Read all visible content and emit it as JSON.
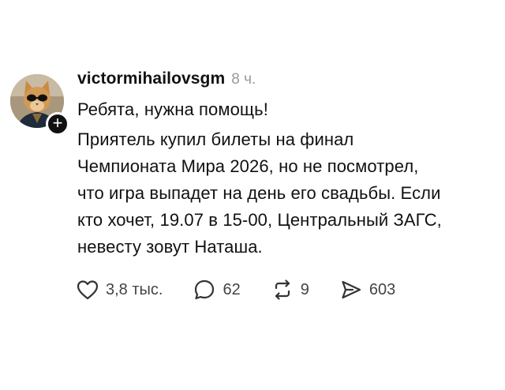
{
  "post": {
    "username": "victormihailovsgm",
    "time": "8 ч.",
    "lines": [
      "Ребята, нужна помощь!",
      "Приятель купил билеты на финал",
      "Чемпионата Мира 2026, но не посмотрел,",
      "что игра выпадет на день его свадьбы. Если",
      "кто хочет, 19.07 в 15-00, Центральный ЗАГС,",
      "невесту зовут Наташа."
    ]
  },
  "avatar": {
    "badge": "+"
  },
  "actions": {
    "likes": "3,8 тыс.",
    "comments": "62",
    "reposts": "9",
    "shares": "603"
  },
  "icons": [
    "heart-icon",
    "comment-bubble-icon",
    "repost-icon",
    "share-send-icon",
    "plus-icon"
  ]
}
